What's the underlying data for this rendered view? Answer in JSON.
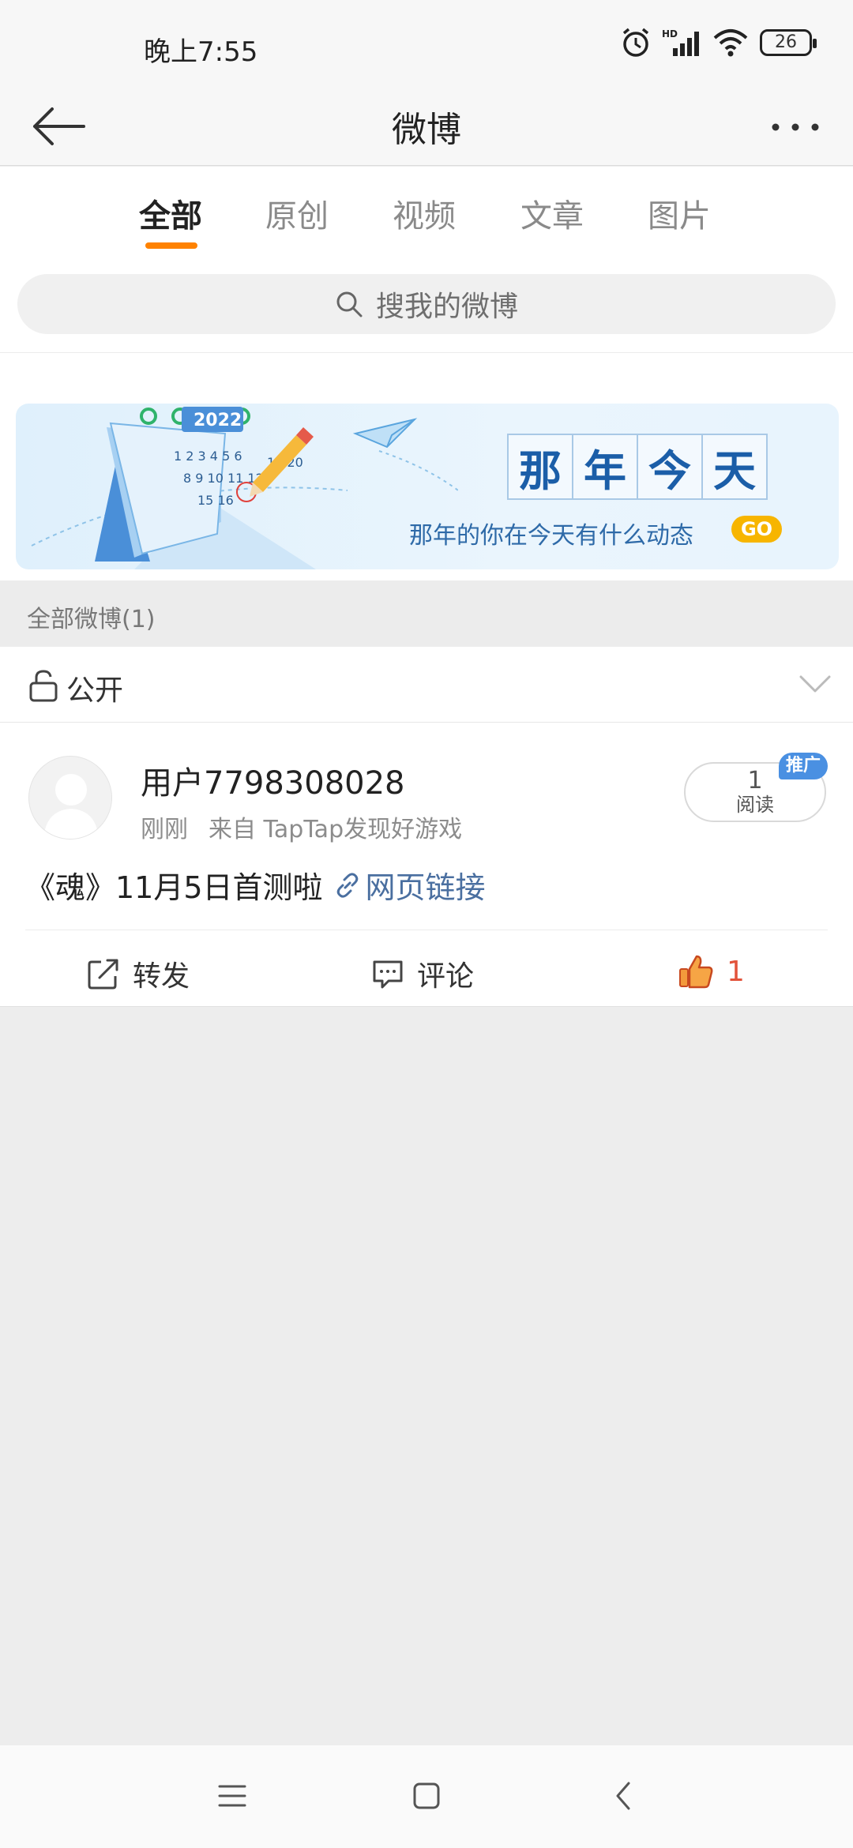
{
  "status_bar": {
    "time": "晚上7:55",
    "battery": "26",
    "signal_label": "HD"
  },
  "header": {
    "title": "微博"
  },
  "tabs": [
    {
      "label": "全部",
      "active": true
    },
    {
      "label": "原创",
      "active": false
    },
    {
      "label": "视频",
      "active": false
    },
    {
      "label": "文章",
      "active": false
    },
    {
      "label": "图片",
      "active": false
    }
  ],
  "search": {
    "placeholder": "搜我的微博"
  },
  "banner": {
    "title_chars": [
      "那",
      "年",
      "今",
      "天"
    ],
    "subtitle": "那年的你在今天有什么动态",
    "go_label": "GO",
    "calendar_year": "2022"
  },
  "section": {
    "label": "全部微博(1)"
  },
  "filter": {
    "label": "公开"
  },
  "post": {
    "user_name": "用户7798308028",
    "time": "刚刚",
    "source": "来自 TapTap发现好游戏",
    "read_count": "1",
    "read_label": "阅读",
    "promo_label": "推广",
    "text": "《魂》11月5日首测啦",
    "link_label": "网页链接",
    "actions": {
      "repost_label": "转发",
      "comment_label": "评论",
      "like_count": "1"
    }
  },
  "colors": {
    "accent": "#ff8200",
    "link": "#4a6fa0",
    "like": "#e2533b",
    "promo": "#4a90e2"
  }
}
